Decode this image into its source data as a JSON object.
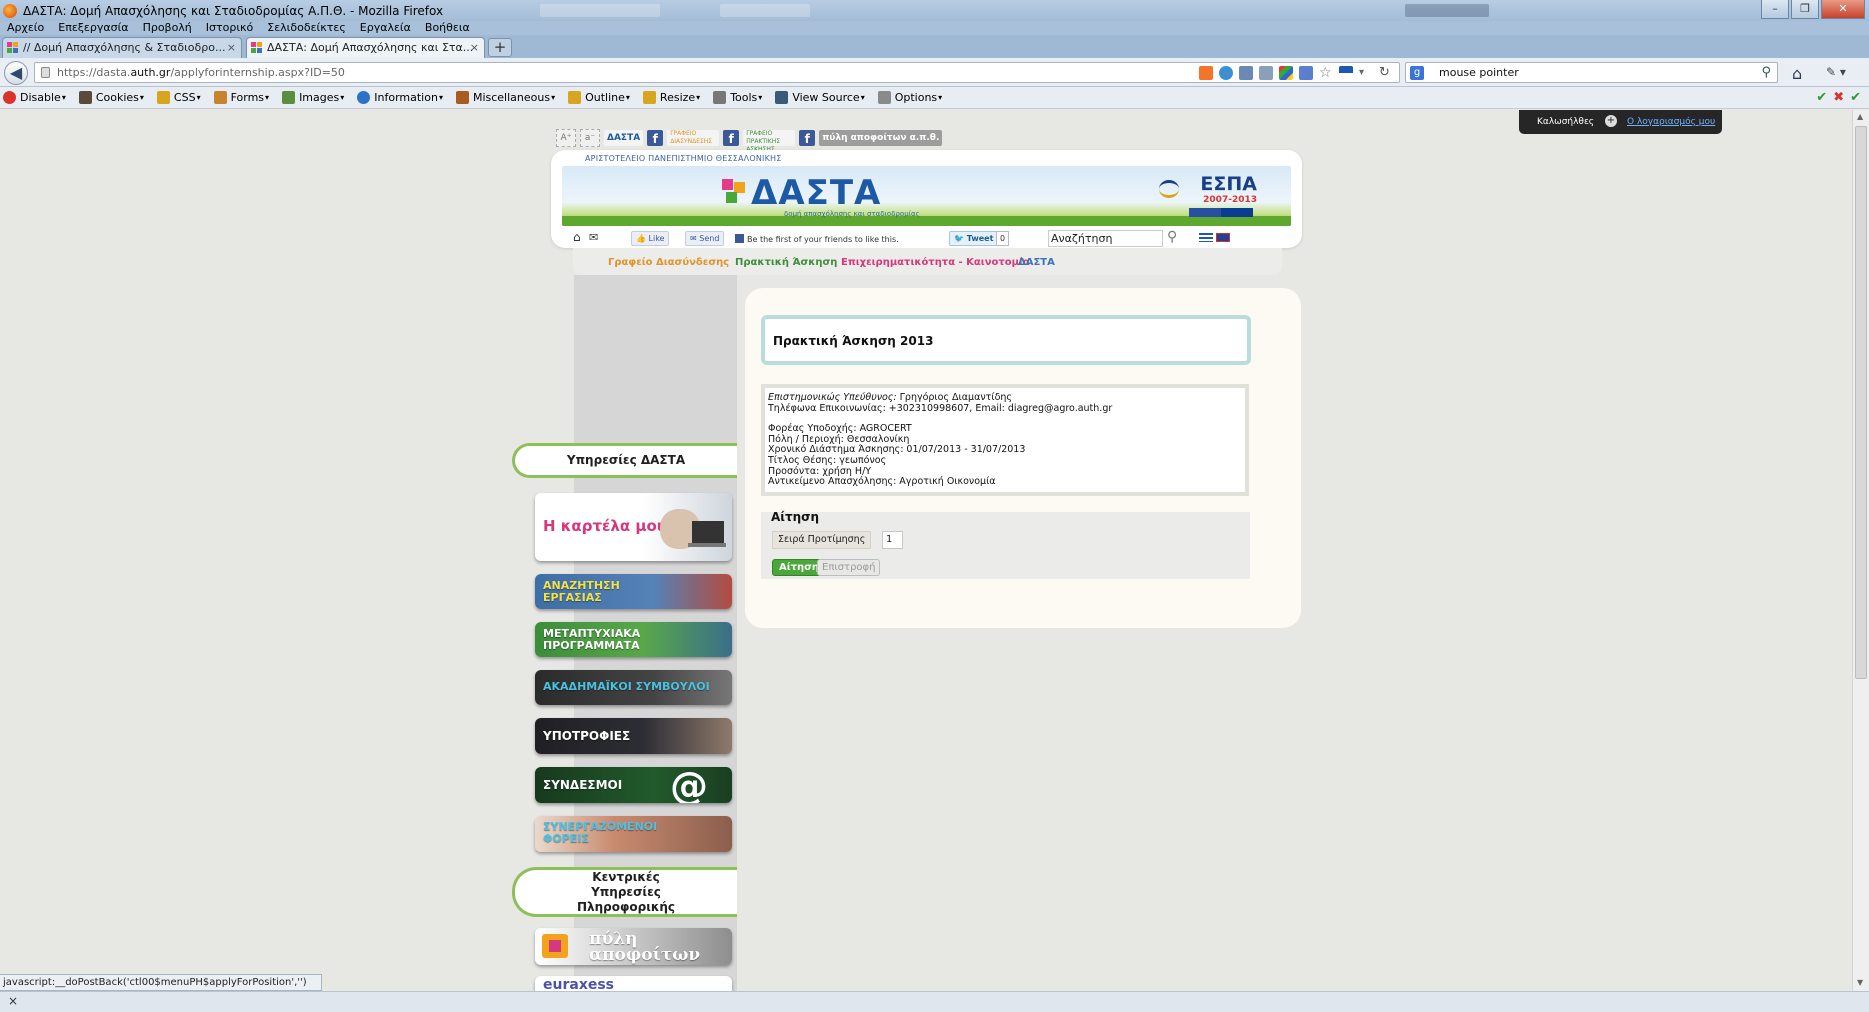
{
  "window": {
    "title": "ΔΑΣΤΑ: Δομή Απασχόλησης και Σταδιοδρομίας Α.Π.Θ. - Mozilla Firefox"
  },
  "menubar": [
    "Αρχείο",
    "Επεξεργασία",
    "Προβολή",
    "Ιστορικό",
    "Σελιδοδείκτες",
    "Εργαλεία",
    "Βοήθεια"
  ],
  "tabs": [
    {
      "label": "// Δομή Απασχόλησης & Σταδιοδρο...",
      "close": "×"
    },
    {
      "label": "ΔΑΣΤΑ: Δομή Απασχόλησης και Στα...",
      "close": "×"
    }
  ],
  "newtab_label": "+",
  "nav": {
    "url_prefix": "https://dasta.",
    "url_domain": "auth.gr",
    "url_rest": "/applyforinternship.aspx?ID=50",
    "search_value": "mouse pointer"
  },
  "devbar": [
    "Disable",
    "Cookies",
    "CSS",
    "Forms",
    "Images",
    "Information",
    "Miscellaneous",
    "Outline",
    "Resize",
    "Tools",
    "View Source",
    "Options"
  ],
  "site_bar": {
    "welcome": "Καλωσήλθες",
    "account_link": "Ο λογαριασμός μου"
  },
  "header": {
    "university": "ΑΡΙΣΤΟΤΕΛΕΙΟ ΠΑΝΕΠΙΣΤΗΜΙΟ ΘΕΣΣΑΛΟΝΙΚΗΣ",
    "site_title": "ΔΑΣΤΑ",
    "site_subtitle": "δομή απασχόλησης και σταδιοδρομίας",
    "espa": "ΕΣΠΑ",
    "espa_years": "2007-2013",
    "like_label": "Like",
    "send_label": "Send",
    "fb_text": "Be the first of your friends to like this.",
    "tweet_label": "Tweet",
    "tweet_count": "0",
    "search_value": "Αναζήτηση",
    "top_logos": [
      "ΔΑΣΤΑ",
      "ΓΡΑΦΕΙΟ ΔΙΑΣΥΝΔΕΣΗΣ",
      "ΓΡΑΦΕΙΟ ΠΡΑΚΤΙΚΗΣ ΑΣΚΗΣΗΣ",
      "πύλη αποφοίτων α.π.θ."
    ]
  },
  "navtabs": [
    {
      "label": "Γραφείο Διασύνδεσης",
      "color": "#e2932a"
    },
    {
      "label": "Πρακτική Άσκηση",
      "color": "#3f8f3a"
    },
    {
      "label": "Επιχειρηματικότητα - Καινοτομία",
      "color": "#d6397b"
    },
    {
      "label": "ΔΑΣΤΑ",
      "color": "#3a73b8"
    }
  ],
  "sidebar": {
    "services_heading": "Υπηρεσίες ΔΑΣΤΑ",
    "buttons": [
      {
        "label": "Η καρτέλα μου"
      },
      {
        "label": "ΑΝΑΖΗΤΗΣΗ ΕΡΓΑΣΙΑΣ"
      },
      {
        "label": "ΜΕΤΑΠΤΥΧΙΑΚΑ ΠΡΟΓΡΑΜΜΑΤΑ"
      },
      {
        "label": "ΑΚΑΔΗΜΑΪΚΟΙ ΣΥΜΒΟΥΛΟΙ"
      },
      {
        "label": "ΥΠΟΤΡΟΦΙΕΣ"
      },
      {
        "label": "ΣΥΝΔΕΣΜΟΙ"
      },
      {
        "label": "ΣΥΝΕΡΓΑΖΟΜΕΝΟΙ ΦΟΡΕΙΣ"
      }
    ],
    "central_heading": "Κεντρικές Υπηρεσίες Πληροφορικής",
    "portal_label": "πύλη αποφοίτων",
    "euraxess_label": "euraxess"
  },
  "main": {
    "title": "Πρακτική Άσκηση 2013",
    "info": {
      "supervisor_label": "Επιστημονικώς Υπεύθυνος:",
      "supervisor": "Γρηγόριος Διαμαντίδης",
      "contact": "Τηλέφωνα Επικοινωνίας: +302310998607, Email: diagreg@agro.auth.gr",
      "host": "Φορέας Υποδοχής: AGROCERT",
      "city": "Πόλη / Περιοχή: Θεσσαλονίκη",
      "period": "Χρονικό Διάστημα Άσκησης: 01/07/2013 - 31/07/2013",
      "position": "Τίτλος Θέσης: γεωπόνος",
      "qualifications": "Προσόντα: χρήση Η/Υ",
      "field": "Αντικείμενο Απασχόλησης: Αγροτική Οικονομία"
    },
    "application": {
      "heading": "Αίτηση",
      "priority_label": "Σειρά Προτίμησης",
      "priority_value": "1",
      "submit_label": "Αίτηση",
      "back_label": "Επιστροφή"
    }
  },
  "status": {
    "link": "javascript:__doPostBack('ctl00$menuPH$applyForPosition','')",
    "close": "×"
  }
}
